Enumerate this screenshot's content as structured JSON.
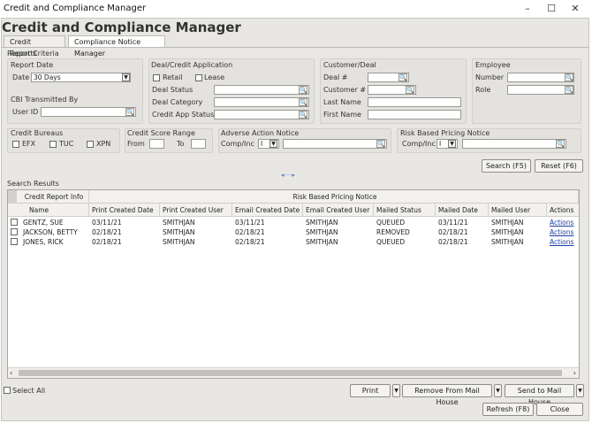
{
  "window": {
    "title": "Credit and Compliance Manager",
    "controls": [
      "–",
      "☐",
      "✕"
    ]
  },
  "app_title": "Credit and Compliance Manager",
  "tabs": [
    {
      "label": "Credit Reports"
    },
    {
      "label": "Compliance Notice Manager"
    }
  ],
  "criteria": {
    "section_label": "Report Criteria",
    "report_date": {
      "label": "Report Date",
      "field_label": "Date",
      "value": "30 Days"
    },
    "cbi": {
      "label": "CBI Transmitted By",
      "field_label": "User ID",
      "value": ""
    },
    "deal_app": {
      "label": "Deal/Credit Application",
      "retail": "Retail",
      "lease": "Lease",
      "status": "Deal Status",
      "category": "Deal Category",
      "credit_app_status": "Credit App Status"
    },
    "customer": {
      "label": "Customer/Deal",
      "deal_no": "Deal #",
      "customer_no": "Customer #",
      "last_name": "Last Name",
      "first_name": "First Name"
    },
    "employee": {
      "label": "Employee",
      "number": "Number",
      "role": "Role"
    },
    "bureaus": {
      "label": "Credit Bureaus",
      "efx": "EFX",
      "tuc": "TUC",
      "xpn": "XPN"
    },
    "score": {
      "label": "Credit Score Range",
      "from": "From",
      "to": "To"
    },
    "adverse": {
      "label": "Adverse Action Notice",
      "comp": "Comp/Inc",
      "comp_value": "I"
    },
    "rbp": {
      "label": "Risk Based Pricing Notice",
      "comp": "Comp/Inc",
      "comp_value": "I"
    }
  },
  "search_button": "Search (F5)",
  "reset_button": "Reset (F6)",
  "results": {
    "label": "Search Results",
    "group_left": "Credit Report Info",
    "group_right": "Risk Based Pricing Notice",
    "columns": [
      "Name",
      "Print Created Date",
      "Print Created User",
      "Email Created Date",
      "Email Created User",
      "Mailed Status",
      "Mailed Date",
      "Mailed User",
      "Actions"
    ],
    "rows": [
      {
        "name": "GENTZ, SUE",
        "print_date": "03/11/21",
        "print_user": "SMITHJAN",
        "email_date": "03/11/21",
        "email_user": "SMITHJAN",
        "mailed_status": "QUEUED",
        "mailed_date": "03/11/21",
        "mailed_user": "SMITHJAN",
        "actions": "Actions"
      },
      {
        "name": "JACKSON, BETTY",
        "print_date": "02/18/21",
        "print_user": "SMITHJAN",
        "email_date": "02/18/21",
        "email_user": "SMITHJAN",
        "mailed_status": "REMOVED",
        "mailed_date": "02/18/21",
        "mailed_user": "SMITHJAN",
        "actions": "Actions"
      },
      {
        "name": "JONES, RICK",
        "print_date": "02/18/21",
        "print_user": "SMITHJAN",
        "email_date": "02/18/21",
        "email_user": "SMITHJAN",
        "mailed_status": "QUEUED",
        "mailed_date": "02/18/21",
        "mailed_user": "SMITHJAN",
        "actions": "Actions"
      }
    ]
  },
  "footer": {
    "select_all": "Select All",
    "print": "Print",
    "remove": "Remove From Mail House",
    "send": "Send to Mail House",
    "refresh": "Refresh (F8)",
    "close": "Close"
  },
  "colors": {
    "background": "#e9e7e3",
    "link": "#1a3ea8"
  }
}
